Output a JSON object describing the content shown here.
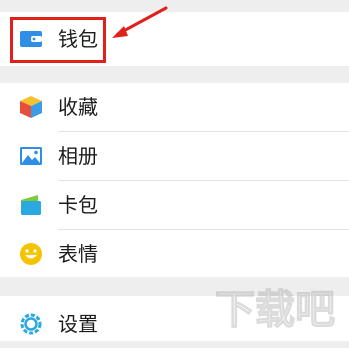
{
  "menu": {
    "wallet_label": "钱包",
    "items": [
      {
        "label": "收藏",
        "icon": "favorites-cube-icon"
      },
      {
        "label": "相册",
        "icon": "album-icon"
      },
      {
        "label": "卡包",
        "icon": "card-pack-icon"
      },
      {
        "label": "表情",
        "icon": "emoji-icon"
      }
    ],
    "settings_label": "设置"
  },
  "annotation": {
    "highlight_color": "#e0201b"
  },
  "watermark": {
    "text": "下载吧"
  },
  "colors": {
    "wallet_icon": "#2f8fe6",
    "favorites_icon": [
      "#e84d3c",
      "#f5c12e",
      "#3a9be6"
    ],
    "album_icon": "#2f8fe6",
    "card_icon": "#2aa8e0",
    "emoji_icon": "#f5c400",
    "settings_icon": "#2aa8e0"
  }
}
